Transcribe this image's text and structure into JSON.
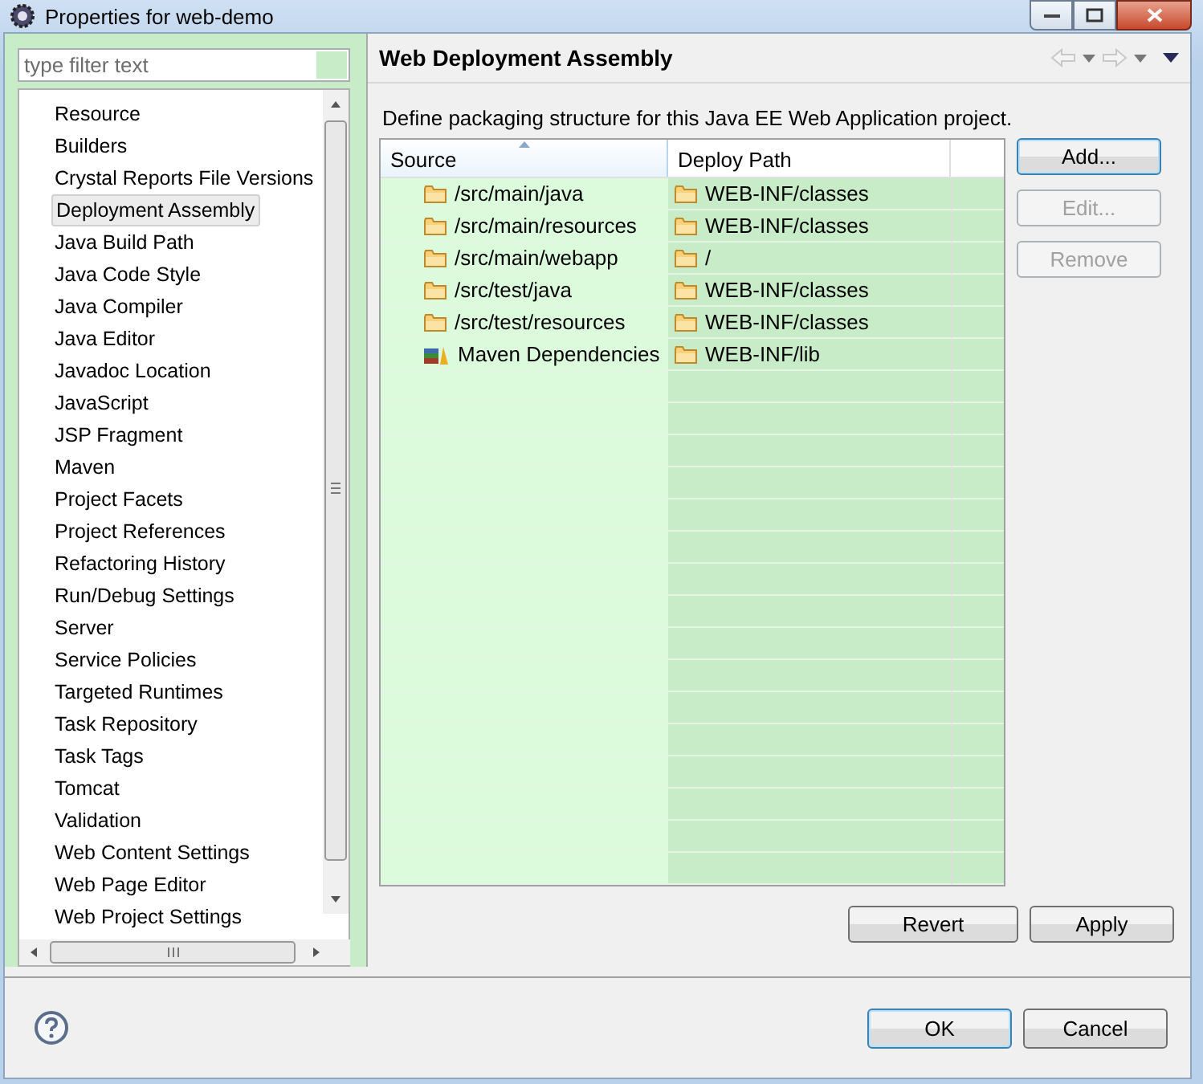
{
  "window": {
    "title": "Properties for web-demo"
  },
  "filter": {
    "placeholder": "type filter text"
  },
  "nav": {
    "items": [
      {
        "label": "Resource",
        "selected": false
      },
      {
        "label": "Builders",
        "selected": false
      },
      {
        "label": "Crystal Reports File Versions",
        "selected": false
      },
      {
        "label": "Deployment Assembly",
        "selected": true
      },
      {
        "label": "Java Build Path",
        "selected": false
      },
      {
        "label": "Java Code Style",
        "selected": false
      },
      {
        "label": "Java Compiler",
        "selected": false
      },
      {
        "label": "Java Editor",
        "selected": false
      },
      {
        "label": "Javadoc Location",
        "selected": false
      },
      {
        "label": "JavaScript",
        "selected": false
      },
      {
        "label": "JSP Fragment",
        "selected": false
      },
      {
        "label": "Maven",
        "selected": false
      },
      {
        "label": "Project Facets",
        "selected": false
      },
      {
        "label": "Project References",
        "selected": false
      },
      {
        "label": "Refactoring History",
        "selected": false
      },
      {
        "label": "Run/Debug Settings",
        "selected": false
      },
      {
        "label": "Server",
        "selected": false
      },
      {
        "label": "Service Policies",
        "selected": false
      },
      {
        "label": "Targeted Runtimes",
        "selected": false
      },
      {
        "label": "Task Repository",
        "selected": false
      },
      {
        "label": "Task Tags",
        "selected": false
      },
      {
        "label": "Tomcat",
        "selected": false
      },
      {
        "label": "Validation",
        "selected": false
      },
      {
        "label": "Web Content Settings",
        "selected": false
      },
      {
        "label": "Web Page Editor",
        "selected": false
      },
      {
        "label": "Web Project Settings",
        "selected": false
      }
    ]
  },
  "page": {
    "title": "Web Deployment Assembly",
    "description": "Define packaging structure for this Java EE Web Application project.",
    "table": {
      "columns": [
        {
          "label": "Source",
          "sorted": true
        },
        {
          "label": "Deploy Path",
          "sorted": false
        }
      ],
      "rows": [
        {
          "kind": "folder",
          "source": "/src/main/java",
          "deploy_path": "WEB-INF/classes"
        },
        {
          "kind": "folder",
          "source": "/src/main/resources",
          "deploy_path": "WEB-INF/classes"
        },
        {
          "kind": "folder",
          "source": "/src/main/webapp",
          "deploy_path": "/"
        },
        {
          "kind": "folder",
          "source": "/src/test/java",
          "deploy_path": "WEB-INF/classes"
        },
        {
          "kind": "folder",
          "source": "/src/test/resources",
          "deploy_path": "WEB-INF/classes"
        },
        {
          "kind": "library",
          "source": "Maven Dependencies",
          "deploy_path": "WEB-INF/lib"
        }
      ]
    },
    "side_buttons": [
      {
        "label": "Add...",
        "disabled": false,
        "focused": true
      },
      {
        "label": "Edit...",
        "disabled": true,
        "focused": false
      },
      {
        "label": "Remove",
        "disabled": true,
        "focused": false
      }
    ],
    "page_buttons": [
      {
        "label": "Revert"
      },
      {
        "label": "Apply"
      }
    ]
  },
  "dialog_buttons": [
    {
      "label": "OK",
      "focused": true
    },
    {
      "label": "Cancel",
      "focused": false
    }
  ]
}
